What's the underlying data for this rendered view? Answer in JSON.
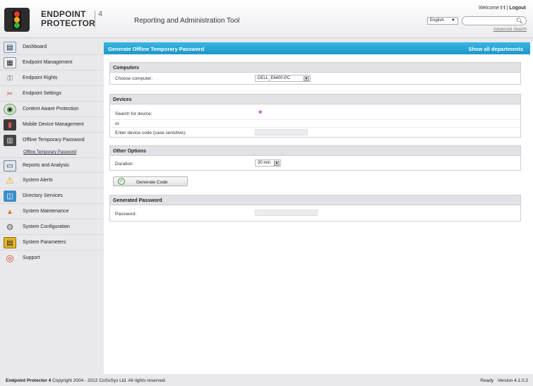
{
  "header": {
    "brand_line1": "ENDPOINT",
    "brand_line2": "PROTECTOR",
    "version": "4",
    "app_title": "Reporting and Administration Tool",
    "welcome_prefix": "Welcome",
    "user": "t t",
    "separator": "|",
    "logout": "Logout",
    "language": "English",
    "search_value": "",
    "advanced_search": "Advanced Search"
  },
  "sidebar": {
    "items": [
      {
        "label": "Dashboard",
        "icon": "dashboard-icon"
      },
      {
        "label": "Endpoint Management",
        "icon": "endpoint-management-icon"
      },
      {
        "label": "Endpoint Rights",
        "icon": "endpoint-rights-icon"
      },
      {
        "label": "Endpoint Settings",
        "icon": "endpoint-settings-icon"
      },
      {
        "label": "Content Aware Protection",
        "icon": "content-aware-icon"
      },
      {
        "label": "Mobile Device Management",
        "icon": "mobile-device-icon"
      },
      {
        "label": "Offline Temporary Password",
        "icon": "offline-password-icon"
      },
      {
        "label": "Reports and Analysis",
        "icon": "reports-icon"
      },
      {
        "label": "System Alerts",
        "icon": "alert-icon"
      },
      {
        "label": "Directory Services",
        "icon": "directory-icon"
      },
      {
        "label": "System Maintenance",
        "icon": "maintenance-icon"
      },
      {
        "label": "System Configuration",
        "icon": "configuration-icon"
      },
      {
        "label": "System Parameters",
        "icon": "parameters-icon"
      },
      {
        "label": "Support",
        "icon": "support-icon"
      }
    ],
    "sub_item": "Offline Temporary Password"
  },
  "main": {
    "title": "Generate Offline Temporary Password",
    "show_all": "Show all departments",
    "computers": {
      "header": "Computers",
      "choose_label": "Choose computer:",
      "computer_value": "DELL_E6400-PC"
    },
    "devices": {
      "header": "Devices",
      "search_label": "Search for device:",
      "or_label": "or",
      "code_label": "Enter device code (case sensitive):",
      "code_value": ""
    },
    "other": {
      "header": "Other Options",
      "duration_label": "Duration:",
      "duration_value": "30 min"
    },
    "generate_button": "Generate Code",
    "generated": {
      "header": "Generated Password",
      "password_label": "Password:",
      "password_value": ""
    }
  },
  "footer": {
    "product": "Endpoint Protector 4",
    "copyright": "Copyright 2004 - 2012 CoSoSys Ltd. All rights reserved.",
    "status": "Ready",
    "version_text": "Version 4.1.0.2"
  },
  "colors": {
    "accent": "#1e97c9",
    "panel_header": "#e2e2e6"
  }
}
